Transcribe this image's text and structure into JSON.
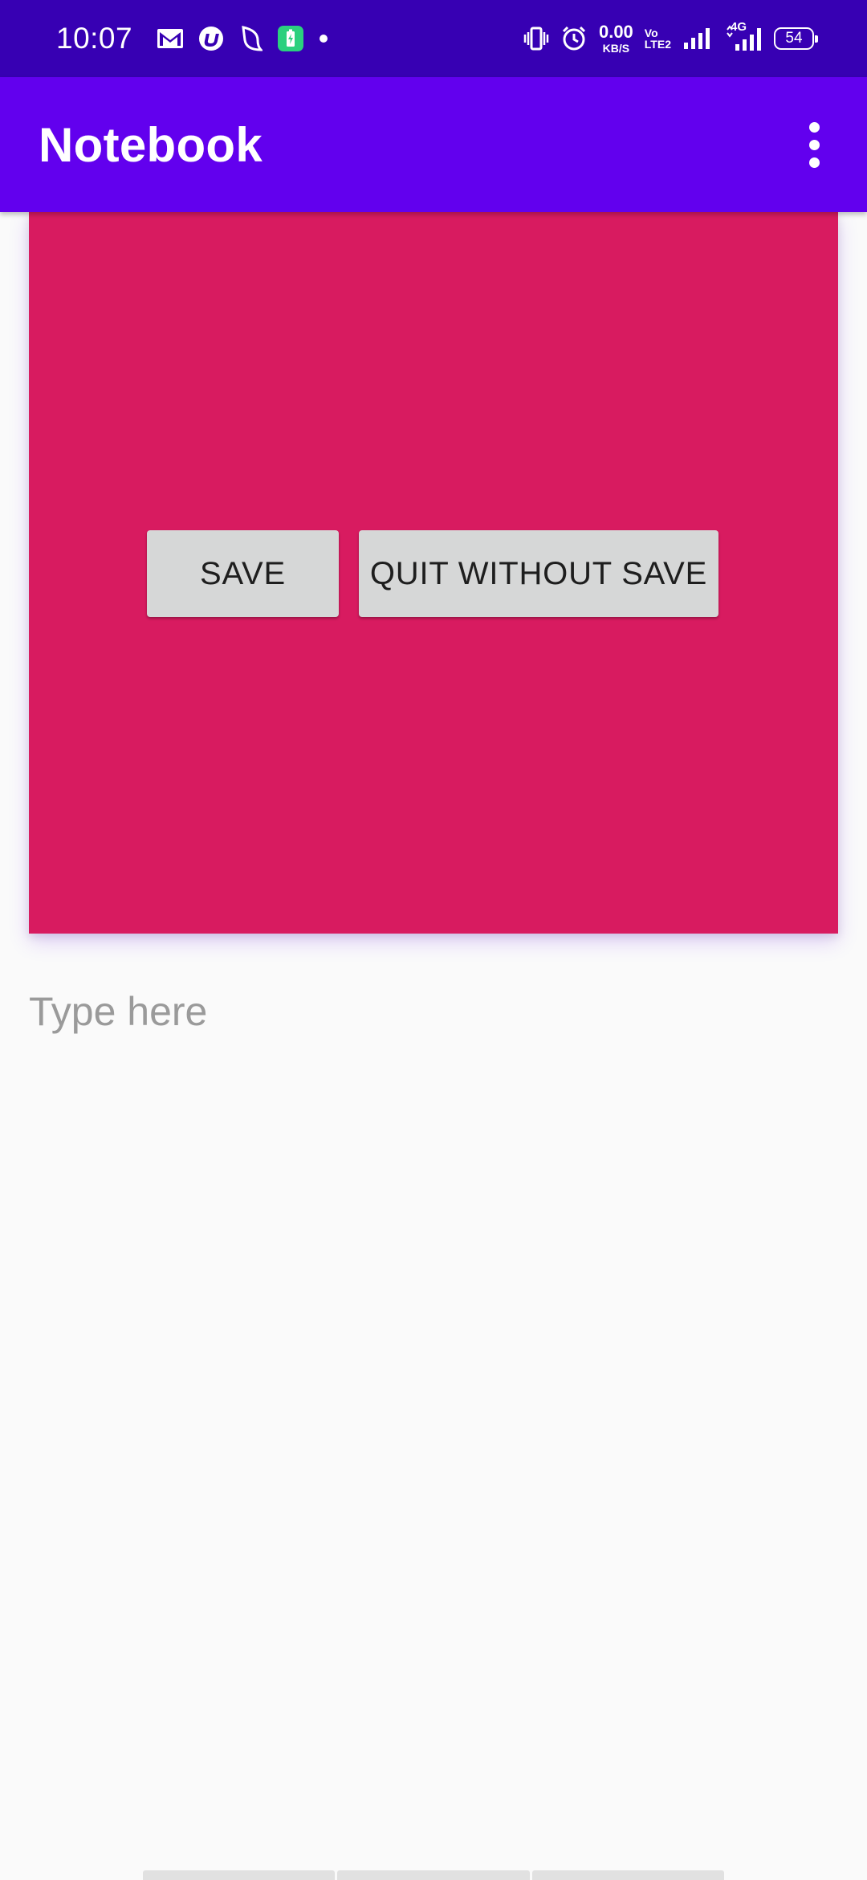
{
  "status_bar": {
    "time": "10:07",
    "notification_icons": [
      "gmail-icon",
      "app-u-icon",
      "moon-icon",
      "battery-saver-icon",
      "dot-icon"
    ],
    "net_speed_value": "0.00",
    "net_speed_unit": "KB/S",
    "volte_top": "Vo",
    "volte_bottom": "LTE2",
    "network_type": "4G",
    "battery": "54"
  },
  "app_bar": {
    "title": "Notebook",
    "menu_icon": "overflow-menu-icon"
  },
  "panel": {
    "background": "#d81b60",
    "save_label": "SAVE",
    "quit_label": "QUIT WITHOUT SAVE"
  },
  "editor": {
    "value": "",
    "placeholder": "Type here"
  },
  "colors": {
    "status_bar": "#3700b3",
    "app_bar": "#6200ee",
    "panel": "#d81b60",
    "button": "#d6d7d7",
    "background": "#fafafa"
  }
}
